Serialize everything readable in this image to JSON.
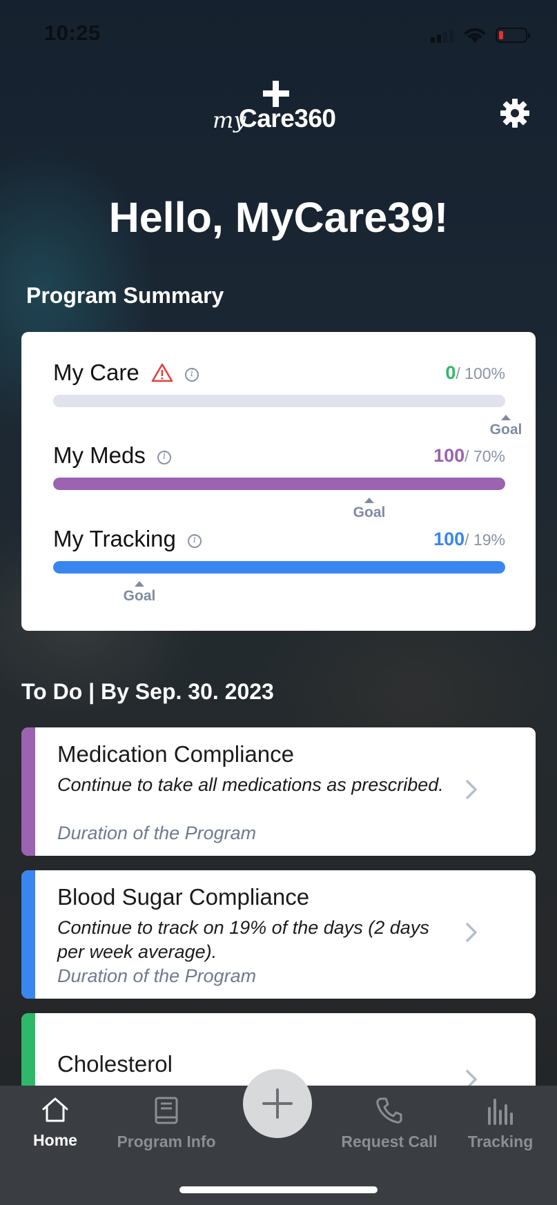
{
  "status_bar": {
    "time": "10:25"
  },
  "header": {
    "logo_script": "my",
    "logo_brand": "Care360"
  },
  "greeting": "Hello, MyCare39!",
  "summary": {
    "title": "Program Summary",
    "goal_label": "Goal",
    "items": [
      {
        "label": "My Care",
        "value": "0",
        "target": "/ 100%",
        "progress": 0,
        "goal_fraction": 1.0,
        "color": "#2fb86a",
        "warning": true
      },
      {
        "label": "My Meds",
        "value": "100",
        "target": "/ 70%",
        "progress": 1.0,
        "goal_fraction": 0.7,
        "color": "#9b63b0",
        "warning": false
      },
      {
        "label": "My Tracking",
        "value": "100",
        "target": "/ 19%",
        "progress": 1.0,
        "goal_fraction": 0.19,
        "color": "#3a86f0",
        "warning": false
      }
    ]
  },
  "todo": {
    "title": "To Do | By Sep. 30. 2023",
    "items": [
      {
        "title": "Medication Compliance",
        "desc": "Continue to take all medications as prescribed.",
        "duration": "Duration of the Program",
        "color": "#9b63b0"
      },
      {
        "title": "Blood Sugar Compliance",
        "desc": "Continue to track on 19% of the days (2 days per week average).",
        "duration": "Duration of the Program",
        "color": "#3a86f0"
      },
      {
        "title": "Cholesterol",
        "desc": "",
        "duration": "",
        "color": "#2fb86a"
      }
    ]
  },
  "tabbar": {
    "home": "Home",
    "program_info": "Program Info",
    "request_call": "Request Call",
    "tracking": "Tracking"
  }
}
